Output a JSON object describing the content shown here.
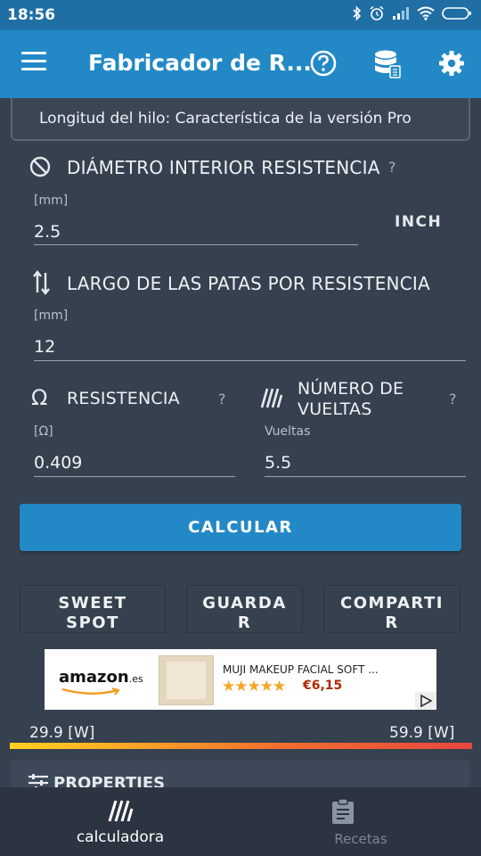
{
  "status": {
    "time": "18:56"
  },
  "app": {
    "title": "Fabricador de R..."
  },
  "info": {
    "text": "Longitud del hilo: Característica de la versión Pro"
  },
  "diameter": {
    "label": "DIÁMETRO INTERIOR RESISTENCIA",
    "help": "?",
    "unit": "[mm]",
    "value": "2.5",
    "toggle": "INCH"
  },
  "legs": {
    "label": "LARGO DE LAS PATAS POR RESISTENCIA",
    "unit": "[mm]",
    "value": "12"
  },
  "resistance": {
    "label": "RESISTENCIA",
    "help": "?",
    "unit": "[Ω]",
    "value": "0.409"
  },
  "turns": {
    "label_line1": "NÚMERO DE",
    "label_line2": "VUELTAS",
    "help": "?",
    "unit": "Vueltas",
    "value": "5.5"
  },
  "actions": {
    "calculate": "CALCULAR",
    "sweet1": "SWEET",
    "sweet2": "SPOT",
    "save1": "GUARDA",
    "save2": "R",
    "share1": "COMPARTI",
    "share2": "R"
  },
  "ad": {
    "brand": "amazon",
    "brand_suffix": ".es",
    "product": "MUJI MAKEUP FACIAL SOFT ...",
    "stars": "★★★★★",
    "price": "€6,15"
  },
  "power": {
    "min": "29.9 [W]",
    "max": "59.9 [W]"
  },
  "properties": {
    "label": "PROPERTIES"
  },
  "nav": {
    "calc": "calculadora",
    "recipes": "Recetas"
  },
  "colors": {
    "primary": "#2389c6",
    "background": "#36414f",
    "bottom_nav": "#2b3440"
  }
}
